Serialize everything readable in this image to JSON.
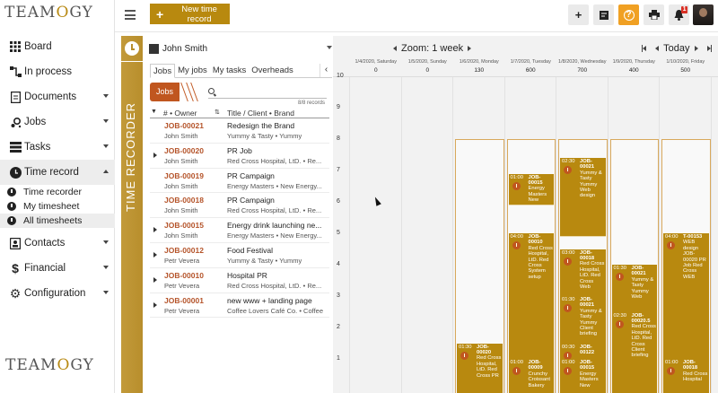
{
  "app": {
    "logo_text": "TEAMOGY"
  },
  "sidebar": {
    "items": [
      {
        "label": "Board",
        "icon": "board-icon"
      },
      {
        "label": "In process",
        "icon": "process-icon"
      },
      {
        "label": "Documents",
        "icon": "documents-icon"
      },
      {
        "label": "Jobs",
        "icon": "jobs-icon"
      },
      {
        "label": "Tasks",
        "icon": "tasks-icon"
      },
      {
        "label": "Time record",
        "icon": "clock-icon"
      },
      {
        "label": "Contacts",
        "icon": "contacts-icon"
      },
      {
        "label": "Financial",
        "icon": "dollar-icon"
      },
      {
        "label": "Configuration",
        "icon": "gear-icon"
      }
    ],
    "sub_items": [
      {
        "label": "Time recorder"
      },
      {
        "label": "My timesheet"
      },
      {
        "label": "All timesheets"
      }
    ]
  },
  "topbar": {
    "new_label": "New time record",
    "notif_count": "1"
  },
  "recorder": {
    "strip_label": "TIME RECORDER"
  },
  "panel": {
    "user": "John Smith",
    "tabs": [
      "Jobs",
      "My jobs",
      "My tasks",
      "Overheads"
    ],
    "crumb": "Jobs",
    "search_placeholder": "",
    "records": "8/8 records",
    "col_owner": "# • Owner",
    "col_title": "Title / Client • Brand",
    "rows": [
      {
        "code": "JOB-00021",
        "owner": "John Smith",
        "title": "Redesign the Brand",
        "client": "Yummy & Tasty • Yummy"
      },
      {
        "code": "JOB-00020",
        "owner": "John Smith",
        "title": "PR Job",
        "client": "Red Cross Hospital, LtD. • Re..."
      },
      {
        "code": "JOB-00019",
        "owner": "John Smith",
        "title": "PR Campaign",
        "client": "Energy Masters • New Energy..."
      },
      {
        "code": "JOB-00018",
        "owner": "John Smith",
        "title": "PR Campaign",
        "client": "Red Cross Hospital, LtD. • Re..."
      },
      {
        "code": "JOB-00015",
        "owner": "John Smith",
        "title": "Energy drink launching ne...",
        "client": "Energy Masters • New Energy..."
      },
      {
        "code": "JOB-00012",
        "owner": "Petr Vevera",
        "title": "Food Festival",
        "client": "Yummy & Tasty • Yummy"
      },
      {
        "code": "JOB-00010",
        "owner": "Petr Vevera",
        "title": "Hospital PR",
        "client": "Red Cross Hospital, LtD. • Re..."
      },
      {
        "code": "JOB-00001",
        "owner": "Petr Vevera",
        "title": "new www + landing page",
        "client": "Coffee Lovers Café Co. • Coffee"
      }
    ]
  },
  "calendar": {
    "zoom": "Zoom: 1 week",
    "today": "Today",
    "days": [
      {
        "date": "1/4/2020, Saturday",
        "minutes": "0"
      },
      {
        "date": "1/5/2020, Sunday",
        "minutes": "0"
      },
      {
        "date": "1/6/2020, Monday",
        "minutes": "130"
      },
      {
        "date": "1/7/2020, Tuesday",
        "minutes": "600"
      },
      {
        "date": "1/8/2020, Wednesday",
        "minutes": "700"
      },
      {
        "date": "1/9/2020, Thursday",
        "minutes": "400"
      },
      {
        "date": "1/10/2020, Friday",
        "minutes": "500"
      }
    ],
    "y_labels": [
      "10",
      "9",
      "8",
      "7",
      "6",
      "5",
      "4",
      "3",
      "2",
      "1"
    ],
    "events": [
      {
        "day": 2,
        "start": 0,
        "end": 1.5,
        "time": "01:30",
        "text": "JOB-00020",
        "sub": "Red Cross Hospital, LtD. Red Cross PR"
      },
      {
        "day": 3,
        "start": 6,
        "end": 6.9,
        "time": "01:00",
        "text": "JOB-00015",
        "sub": "Energy Masters New"
      },
      {
        "day": 3,
        "start": 1,
        "end": 5,
        "time": "04:00",
        "text": "JOB-00010",
        "sub": "Red Cross Hospital, LtD. Red Cross System setup"
      },
      {
        "day": 3,
        "start": 0,
        "end": 1,
        "time": "01:00",
        "text": "JOB-00009",
        "sub": "Crunchy Croissant Bakery"
      },
      {
        "day": 4,
        "start": 5,
        "end": 7.4,
        "time": "02:30",
        "text": "JOB-00021",
        "sub": "Yummy & Tasty Yummy Web design"
      },
      {
        "day": 4,
        "start": 3,
        "end": 4.5,
        "time": "03:00",
        "text": "JOB-00018",
        "sub": "Red Cross Hospital, LtD. Red Cross Web"
      },
      {
        "day": 4,
        "start": 1.5,
        "end": 3,
        "time": "01:30",
        "text": "JOB-00021",
        "sub": "Yummy & Tasty Yummy Client briefing"
      },
      {
        "day": 4,
        "start": 1,
        "end": 1.5,
        "time": "00:30",
        "text": "JOB-00122",
        "sub": ""
      },
      {
        "day": 4,
        "start": 0,
        "end": 1,
        "time": "01:00",
        "text": "JOB-00015",
        "sub": "Energy Masters New"
      },
      {
        "day": 5,
        "start": 2.5,
        "end": 4,
        "time": "01:30",
        "text": "JOB-00021",
        "sub": "Yummy & Tasty Yummy Web"
      },
      {
        "day": 5,
        "start": 0,
        "end": 2.5,
        "time": "02:30",
        "text": "JOB-00020.5",
        "sub": "Red Cross Hospital, LtD. Red Cross Client briefing"
      },
      {
        "day": 6,
        "start": 1,
        "end": 5,
        "time": "04:00",
        "text": "T-00153",
        "sub": "WEB design JOB-00020 PR Job Red Cross WEB"
      },
      {
        "day": 6,
        "start": 0,
        "end": 1,
        "time": "01:00",
        "text": "JOB-00018",
        "sub": "Red Cross Hospital"
      }
    ]
  },
  "colors": {
    "accent": "#b8890f",
    "job_code": "#b5542a",
    "crumb": "#c0561f"
  }
}
